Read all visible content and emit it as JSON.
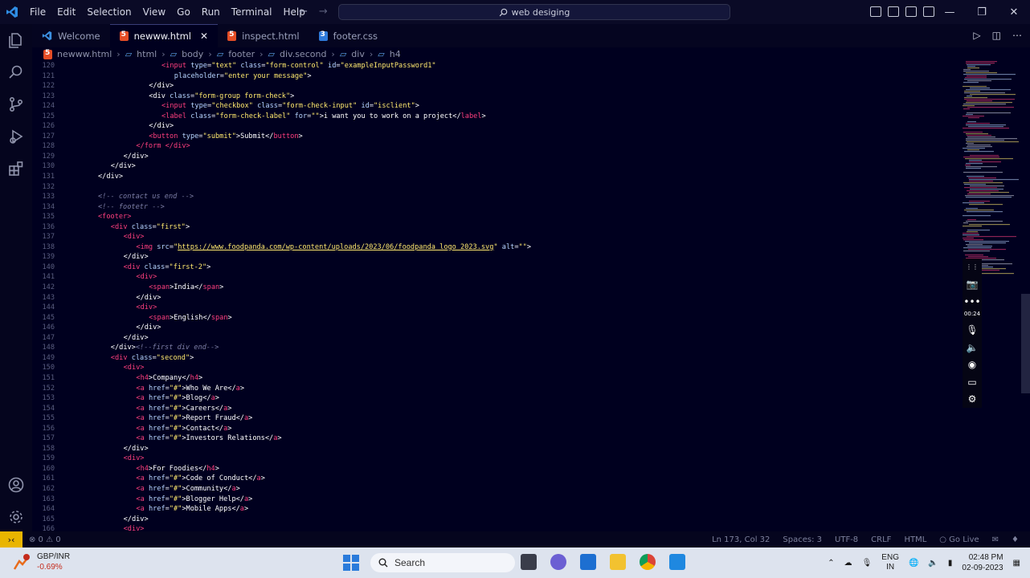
{
  "titlebar": {
    "menu": [
      "File",
      "Edit",
      "Selection",
      "View",
      "Go",
      "Run",
      "Terminal",
      "Help"
    ],
    "search_text": "web desiging"
  },
  "tabs": [
    {
      "label": "Welcome",
      "icon": "vscode-icon"
    },
    {
      "label": "newww.html",
      "icon": "html-file-icon",
      "active": true
    },
    {
      "label": "inspect.html",
      "icon": "html-file-icon"
    },
    {
      "label": "footer.css",
      "icon": "css-file-icon"
    }
  ],
  "breadcrumb": [
    "newww.html",
    "html",
    "body",
    "footer",
    "div.second",
    "div",
    "h4"
  ],
  "statusbar": {
    "problems": "⊗ 0 ⚠ 0",
    "position": "Ln 173, Col 32",
    "spaces": "Spaces: 3",
    "encoding": "UTF-8",
    "eol": "CRLF",
    "language": "HTML",
    "golive": "○ Go Live"
  },
  "recorder": {
    "time": "00:24"
  },
  "taskbar": {
    "ticker": "GBP/INR",
    "change": "-0.69%",
    "search": "Search",
    "lang1": "ENG",
    "lang2": "IN",
    "time": "02:48 PM",
    "date": "02-09-2023"
  },
  "code_lines": [
    {
      "n": "120",
      "indent": 10,
      "html": "<span class='t'>&lt;input</span> <span class='a'>type</span>=<span class='s'>\"text\"</span> <span class='a'>class</span>=<span class='s'>\"form-control\"</span> <span class='a'>id</span>=<span class='s'>\"exampleInputPassword1\"</span>"
    },
    {
      "n": "121",
      "indent": 12,
      "html": "<span class='a'>placeholder</span>=<span class='s'>\"enter your message\"</span><span class='w'>&gt;</span>"
    },
    {
      "n": "122",
      "indent": 8,
      "html": "<span class='w'>&lt;/div&gt;</span>"
    },
    {
      "n": "123",
      "indent": 8,
      "html": "<span class='w'>&lt;div</span> <span class='a'>class</span>=<span class='s'>\"form-group form-check\"</span><span class='w'>&gt;</span>"
    },
    {
      "n": "124",
      "indent": 10,
      "html": "<span class='t'>&lt;input</span> <span class='a'>type</span>=<span class='s'>\"checkbox\"</span> <span class='a'>class</span>=<span class='s'>\"form-check-input\"</span> <span class='a'>id</span>=<span class='s'>\"isclient\"</span><span class='w'>&gt;</span>"
    },
    {
      "n": "125",
      "indent": 10,
      "html": "<span class='t'>&lt;label</span> <span class='a'>class</span>=<span class='s'>\"form-check-label\"</span> <span class='a'>for</span>=<span class='s'>\"\"</span><span class='w'>&gt;i want you to work on a project&lt;/</span><span class='t'>label</span><span class='w'>&gt;</span>"
    },
    {
      "n": "126",
      "indent": 8,
      "html": "<span class='w'>&lt;/div&gt;</span>"
    },
    {
      "n": "127",
      "indent": 8,
      "html": "<span class='t'>&lt;button</span> <span class='a'>type</span>=<span class='s'>\"submit\"</span><span class='w'>&gt;Submit&lt;/</span><span class='t'>button</span><span class='w'>&gt;</span>"
    },
    {
      "n": "128",
      "indent": 6,
      "html": "<span class='t'>&lt;/form</span> <span class='t'>&lt;/div&gt;</span>"
    },
    {
      "n": "129",
      "indent": 4,
      "html": "<span class='w'>&lt;/div&gt;</span>"
    },
    {
      "n": "130",
      "indent": 2,
      "html": "<span class='w'>&lt;/div&gt;</span>"
    },
    {
      "n": "131",
      "indent": 0,
      "html": "<span class='w'>&lt;/div&gt;</span>"
    },
    {
      "n": "132",
      "indent": 0,
      "html": ""
    },
    {
      "n": "133",
      "indent": 0,
      "html": "<span class='c'>&lt;!-- contact us end --&gt;</span>"
    },
    {
      "n": "134",
      "indent": 0,
      "html": "<span class='c'>&lt;!-- footetr --&gt;</span>"
    },
    {
      "n": "135",
      "indent": 0,
      "html": "<span class='t'>&lt;footer&gt;</span>"
    },
    {
      "n": "136",
      "indent": 2,
      "html": "<span class='t'>&lt;div</span> <span class='a'>class</span>=<span class='s'>\"first\"</span><span class='w'>&gt;</span>"
    },
    {
      "n": "137",
      "indent": 4,
      "html": "<span class='t'>&lt;div&gt;</span>"
    },
    {
      "n": "138",
      "indent": 6,
      "html": "<span class='t'>&lt;img</span> <span class='a'>src</span>=<span class='s'>\"</span><span class='u'>https://www.foodpanda.com/wp-content/uploads/2023/06/foodpanda_logo_2023.svg</span><span class='s'>\"</span> <span class='a'>alt</span>=<span class='s'>\"\"</span><span class='w'>&gt;</span>"
    },
    {
      "n": "139",
      "indent": 4,
      "html": "<span class='w'>&lt;/div&gt;</span>"
    },
    {
      "n": "140",
      "indent": 4,
      "html": "<span class='t'>&lt;div</span> <span class='a'>class</span>=<span class='s'>\"first-2\"</span><span class='w'>&gt;</span>"
    },
    {
      "n": "141",
      "indent": 6,
      "html": "<span class='t'>&lt;div&gt;</span>"
    },
    {
      "n": "142",
      "indent": 8,
      "html": "<span class='t'>&lt;span</span><span class='w'>&gt;India&lt;/</span><span class='t'>span</span><span class='w'>&gt;</span>"
    },
    {
      "n": "143",
      "indent": 6,
      "html": "<span class='w'>&lt;/div&gt;</span>"
    },
    {
      "n": "144",
      "indent": 6,
      "html": "<span class='t'>&lt;div&gt;</span>"
    },
    {
      "n": "145",
      "indent": 8,
      "html": "<span class='t'>&lt;span</span><span class='w'>&gt;English&lt;/</span><span class='t'>span</span><span class='w'>&gt;</span>"
    },
    {
      "n": "146",
      "indent": 6,
      "html": "<span class='w'>&lt;/div&gt;</span>"
    },
    {
      "n": "147",
      "indent": 4,
      "html": "<span class='w'>&lt;/div&gt;</span>"
    },
    {
      "n": "148",
      "indent": 2,
      "html": "<span class='w'>&lt;/div&gt;</span><span class='c'>&lt;!--first div end--&gt;</span>"
    },
    {
      "n": "149",
      "indent": 2,
      "html": "<span class='t'>&lt;div</span> <span class='a'>class</span>=<span class='s'>\"second\"</span><span class='w'>&gt;</span>"
    },
    {
      "n": "150",
      "indent": 4,
      "html": "<span class='t'>&lt;div&gt;</span>"
    },
    {
      "n": "151",
      "indent": 6,
      "html": "<span class='t'>&lt;h4</span><span class='w'>&gt;Company&lt;/</span><span class='t'>h4</span><span class='w'>&gt;</span>"
    },
    {
      "n": "152",
      "indent": 6,
      "html": "<span class='t'>&lt;a</span> <span class='a'>href</span>=<span class='s'>\"#\"</span><span class='w'>&gt;Who We Are&lt;/</span><span class='t'>a</span><span class='w'>&gt;</span>"
    },
    {
      "n": "153",
      "indent": 6,
      "html": "<span class='t'>&lt;a</span> <span class='a'>href</span>=<span class='s'>\"#\"</span><span class='w'>&gt;Blog&lt;/</span><span class='t'>a</span><span class='w'>&gt;</span>"
    },
    {
      "n": "154",
      "indent": 6,
      "html": "<span class='t'>&lt;a</span> <span class='a'>href</span>=<span class='s'>\"#\"</span><span class='w'>&gt;Careers&lt;/</span><span class='t'>a</span><span class='w'>&gt;</span>"
    },
    {
      "n": "155",
      "indent": 6,
      "html": "<span class='t'>&lt;a</span> <span class='a'>href</span>=<span class='s'>\"#\"</span><span class='w'>&gt;Report Fraud&lt;/</span><span class='t'>a</span><span class='w'>&gt;</span>"
    },
    {
      "n": "156",
      "indent": 6,
      "html": "<span class='t'>&lt;a</span> <span class='a'>href</span>=<span class='s'>\"#\"</span><span class='w'>&gt;Contact&lt;/</span><span class='t'>a</span><span class='w'>&gt;</span>"
    },
    {
      "n": "157",
      "indent": 6,
      "html": "<span class='t'>&lt;a</span> <span class='a'>href</span>=<span class='s'>\"#\"</span><span class='w'>&gt;Investors Relations&lt;/</span><span class='t'>a</span><span class='w'>&gt;</span>"
    },
    {
      "n": "158",
      "indent": 4,
      "html": "<span class='w'>&lt;/div&gt;</span>"
    },
    {
      "n": "159",
      "indent": 4,
      "html": "<span class='t'>&lt;div&gt;</span>"
    },
    {
      "n": "160",
      "indent": 6,
      "html": "<span class='t'>&lt;h4</span><span class='w'>&gt;For Foodies&lt;/</span><span class='t'>h4</span><span class='w'>&gt;</span>"
    },
    {
      "n": "161",
      "indent": 6,
      "html": "<span class='t'>&lt;a</span> <span class='a'>href</span>=<span class='s'>\"#\"</span><span class='w'>&gt;Code of Conduct&lt;/</span><span class='t'>a</span><span class='w'>&gt;</span>"
    },
    {
      "n": "162",
      "indent": 6,
      "html": "<span class='t'>&lt;a</span> <span class='a'>href</span>=<span class='s'>\"#\"</span><span class='w'>&gt;Community&lt;/</span><span class='t'>a</span><span class='w'>&gt;</span>"
    },
    {
      "n": "163",
      "indent": 6,
      "html": "<span class='t'>&lt;a</span> <span class='a'>href</span>=<span class='s'>\"#\"</span><span class='w'>&gt;Blogger Help&lt;/</span><span class='t'>a</span><span class='w'>&gt;</span>"
    },
    {
      "n": "164",
      "indent": 6,
      "html": "<span class='t'>&lt;a</span> <span class='a'>href</span>=<span class='s'>\"#\"</span><span class='w'>&gt;Mobile Apps&lt;/</span><span class='t'>a</span><span class='w'>&gt;</span>"
    },
    {
      "n": "165",
      "indent": 4,
      "html": "<span class='w'>&lt;/div&gt;</span>"
    },
    {
      "n": "166",
      "indent": 4,
      "html": "<span class='t'>&lt;div&gt;</span>"
    }
  ]
}
